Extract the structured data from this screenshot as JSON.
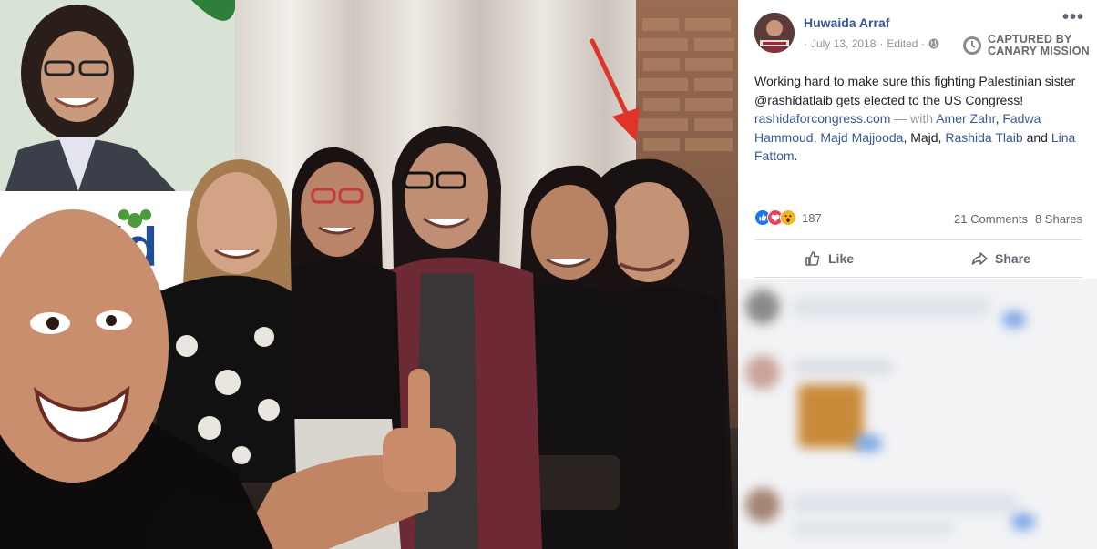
{
  "post": {
    "author": "Huwaida Arraf",
    "date": "July 13, 2018",
    "separator": "·",
    "edited": "Edited ·",
    "more": "•••",
    "watermark_line1": "CAPTURED BY",
    "watermark_line2": "CANARY MISSION",
    "text_part1": "Working hard to make sure this fighting Palestinian sister @rashidatlaib gets elected to the US Congress! ",
    "link_site": "rashidaforcongress.com",
    "with_text": " — with ",
    "tag1": "Amer Zahr",
    "comma1": ", ",
    "tag2": "Fadwa Hammoud",
    "comma2": ", ",
    "tag3": "Majd Majjooda",
    "plain_majd": ", Majd, ",
    "tag4": "Rashida Tlaib",
    "and_text": " and ",
    "tag5": "Lina Fattom",
    "period": "."
  },
  "engagement": {
    "reaction_count": "187",
    "comments": "21 Comments",
    "shares": "8 Shares"
  },
  "actions": {
    "like": "Like",
    "share": "Share"
  },
  "colors": {
    "link": "#365899",
    "like_blue": "#1877f2",
    "love_red": "#f33e58",
    "wow_yellow": "#f7b125",
    "arrow_red": "#e0342a"
  }
}
